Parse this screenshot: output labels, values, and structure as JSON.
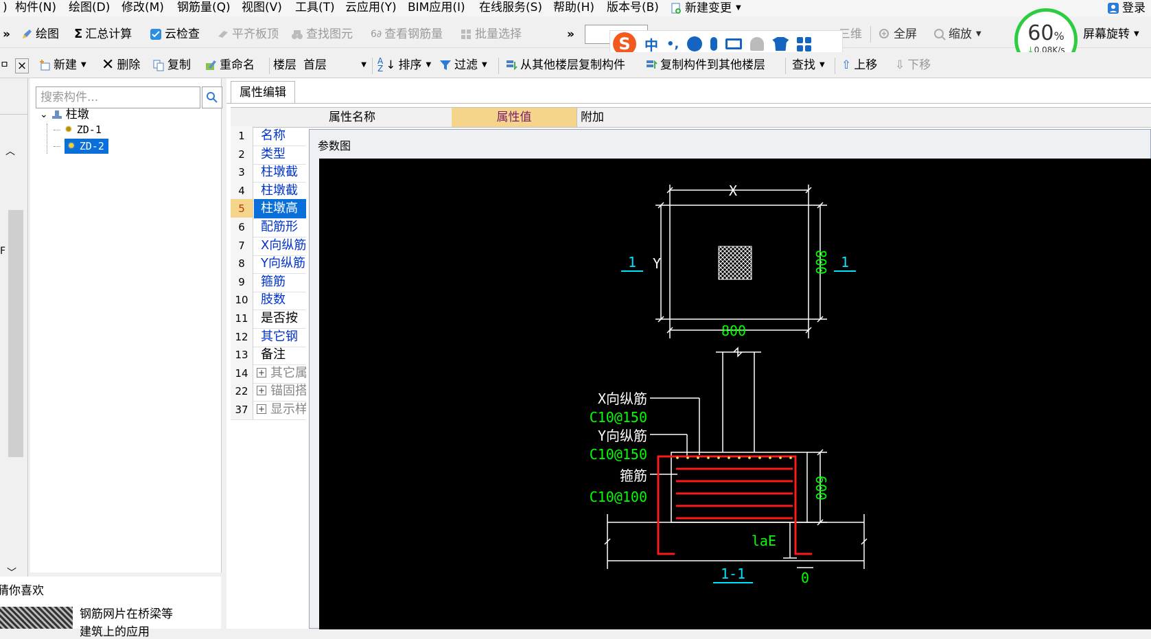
{
  "menu": [
    "构件(N)",
    "绘图(D)",
    "修改(M)",
    "钢筋量(Q)",
    "视图(V)",
    "工具(T)",
    "云应用(Y)",
    "BIM应用(I)",
    "在线服务(S)",
    "帮助(H)",
    "版本号(B)",
    "新建变更"
  ],
  "menu_prefix": ")",
  "login": "登录",
  "toolbar1": {
    "overflow": "»",
    "draw": "绘图",
    "sum_calc": "汇总计算",
    "cloud_check": "云检查",
    "level_slab_top": "平齐板顶",
    "find_element": "查找图元",
    "view_rebar": "查看钢筋量",
    "batch_select": "批量选择",
    "overflow2": "»",
    "view3d": "三维",
    "fullscreen": "全屏",
    "zoom": "缩放",
    "rotate_screen": "屏幕旋转"
  },
  "toolbar2": {
    "new": "新建",
    "delete": "删除",
    "copy": "复制",
    "rename": "重命名",
    "floor_label": "楼层",
    "floor_value": "首层",
    "sort": "排序",
    "filter": "过滤",
    "copy_from_floor": "从其他楼层复制构件",
    "copy_to_floor": "复制构件到其他楼层",
    "find": "查找",
    "move_up": "上移",
    "move_down": "下移"
  },
  "left_strip": {
    "pin": "ㅁ",
    "close": "×",
    "letter": "F"
  },
  "tree": {
    "search_placeholder": "搜索构件...",
    "root": "柱墩",
    "children": [
      "ZD-1",
      "ZD-2"
    ],
    "selected": "ZD-2"
  },
  "recommend": {
    "title": "猜你喜欢",
    "item": "钢筋网片在桥梁等",
    "item2": "建筑上的应用"
  },
  "props": {
    "tab": "属性编辑",
    "col_name": "属性名称",
    "col_value": "属性值",
    "col_extra": "附加",
    "rows": [
      {
        "n": "1",
        "name": "名称",
        "color": "#0033cc"
      },
      {
        "n": "2",
        "name": "类型",
        "color": "#0033cc"
      },
      {
        "n": "3",
        "name": "柱墩截",
        "color": "#0033cc"
      },
      {
        "n": "4",
        "name": "柱墩截",
        "color": "#0033cc"
      },
      {
        "n": "5",
        "name": "柱墩高",
        "color": "#ffffff",
        "selected": true
      },
      {
        "n": "6",
        "name": "配筋形",
        "color": "#0033cc"
      },
      {
        "n": "7",
        "name": "X向纵筋",
        "color": "#0033cc"
      },
      {
        "n": "8",
        "name": "Y向纵筋",
        "color": "#0033cc"
      },
      {
        "n": "9",
        "name": "箍筋",
        "color": "#0033cc"
      },
      {
        "n": "10",
        "name": "肢数",
        "color": "#0033cc"
      },
      {
        "n": "11",
        "name": "是否按",
        "color": "#000000"
      },
      {
        "n": "12",
        "name": "其它钢",
        "color": "#0033cc"
      },
      {
        "n": "13",
        "name": "备注",
        "color": "#000000"
      },
      {
        "n": "14",
        "name": "其它属",
        "color": "#888888",
        "group": true
      },
      {
        "n": "22",
        "name": "锚固搭",
        "color": "#888888",
        "group": true
      },
      {
        "n": "37",
        "name": "显示样",
        "color": "#888888",
        "group": true
      }
    ]
  },
  "param_window": {
    "title": "参数图",
    "labels": {
      "x_dim": "X",
      "y_dim": "Y",
      "section_left": "1",
      "section_right": "1",
      "dim_800_right": "800",
      "dim_800_bottom": "800",
      "x_rebar": "X向纵筋",
      "x_rebar_spec": "C10@150",
      "y_rebar": "Y向纵筋",
      "y_rebar_spec": "C10@150",
      "stirrup": "箍筋",
      "stirrup_spec": "C10@100",
      "dim_600": "600",
      "lae": "laE",
      "zero": "0",
      "section_name": "1-1"
    }
  },
  "ime": {
    "lang": "中",
    "punct": "•,"
  },
  "speed": {
    "percent": "60",
    "unit": "%",
    "rate": "0.08K/s"
  },
  "colors": {
    "selection": "#0a6fd8",
    "value_header": "#f5d58c",
    "drawing_green": "#00ff00",
    "drawing_cyan": "#00e5ff",
    "rebar_red": "#ff1a1a"
  }
}
